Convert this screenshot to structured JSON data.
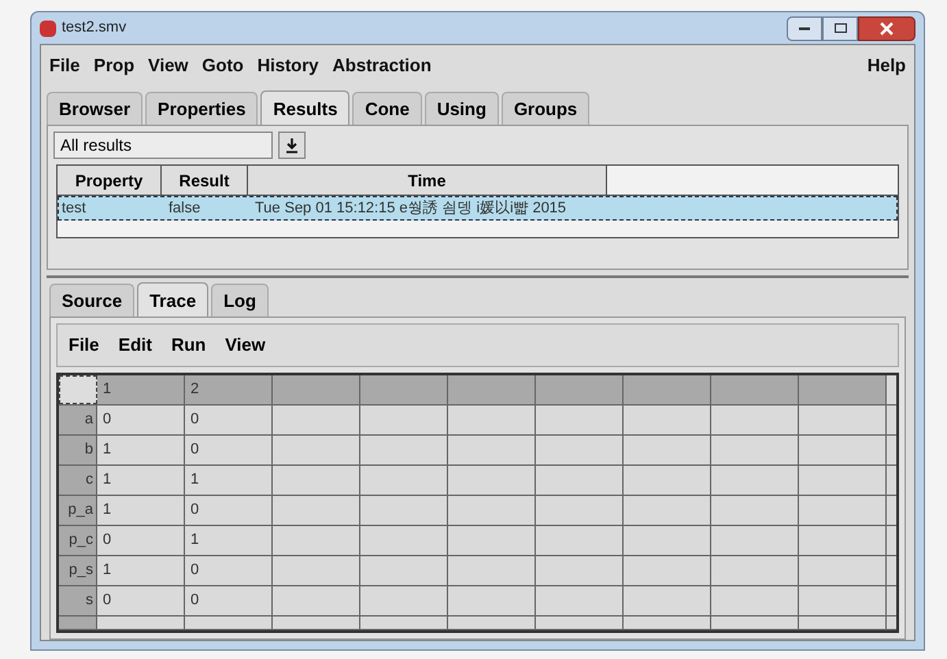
{
  "window": {
    "title": "test2.smv"
  },
  "menu": {
    "items": [
      "File",
      "Prop",
      "View",
      "Goto",
      "History",
      "Abstraction"
    ],
    "help": "Help"
  },
  "tabs": [
    {
      "label": "Browser",
      "selected": false
    },
    {
      "label": "Properties",
      "selected": false
    },
    {
      "label": "Results",
      "selected": true
    },
    {
      "label": "Cone",
      "selected": false
    },
    {
      "label": "Using",
      "selected": false
    },
    {
      "label": "Groups",
      "selected": false
    }
  ],
  "filter": {
    "value": "All results"
  },
  "results": {
    "columns": [
      "Property",
      "Result",
      "Time"
    ],
    "rows": [
      {
        "property": "test",
        "result": "false",
        "time": "Tue Sep 01 15:12:15 e쒕誘 쇰뎅 i媛以i뺣 2015",
        "selected": true
      }
    ]
  },
  "lower_tabs": [
    {
      "label": "Source",
      "selected": false
    },
    {
      "label": "Trace",
      "selected": true
    },
    {
      "label": "Log",
      "selected": false
    }
  ],
  "trace_menu": [
    "File",
    "Edit",
    "Run",
    "View"
  ],
  "trace": {
    "columns": [
      "1",
      "2"
    ],
    "rows": [
      {
        "name": "a",
        "values": [
          "0",
          "0"
        ]
      },
      {
        "name": "b",
        "values": [
          "1",
          "0"
        ]
      },
      {
        "name": "c",
        "values": [
          "1",
          "1"
        ]
      },
      {
        "name": "p_a",
        "values": [
          "1",
          "0"
        ]
      },
      {
        "name": "p_c",
        "values": [
          "0",
          "1"
        ]
      },
      {
        "name": "p_s",
        "values": [
          "1",
          "0"
        ]
      },
      {
        "name": "s",
        "values": [
          "0",
          "0"
        ]
      }
    ]
  }
}
